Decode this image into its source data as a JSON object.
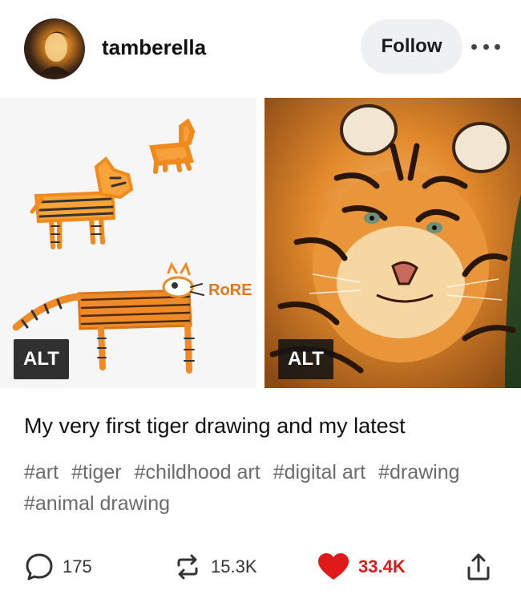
{
  "post": {
    "username": "tamberella",
    "follow_label": "Follow",
    "images": [
      {
        "alt_label": "ALT",
        "scribble_text": "RoRE"
      },
      {
        "alt_label": "ALT"
      }
    ],
    "caption": "My very first tiger drawing and my latest",
    "tags": [
      "#art",
      "#tiger",
      "#childhood art",
      "#digital art",
      "#drawing",
      "#animal drawing"
    ],
    "counts": {
      "comments": "175",
      "reblogs": "15.3K",
      "likes": "33.4K"
    }
  },
  "colors": {
    "like_red": "#e0191a",
    "tag_gray": "#6b6b6b",
    "follow_bg": "#eef0f2",
    "crayon_orange": "#f08a1c"
  },
  "icons": [
    "more-icon",
    "comment-icon",
    "reblog-icon",
    "heart-icon",
    "share-icon"
  ]
}
